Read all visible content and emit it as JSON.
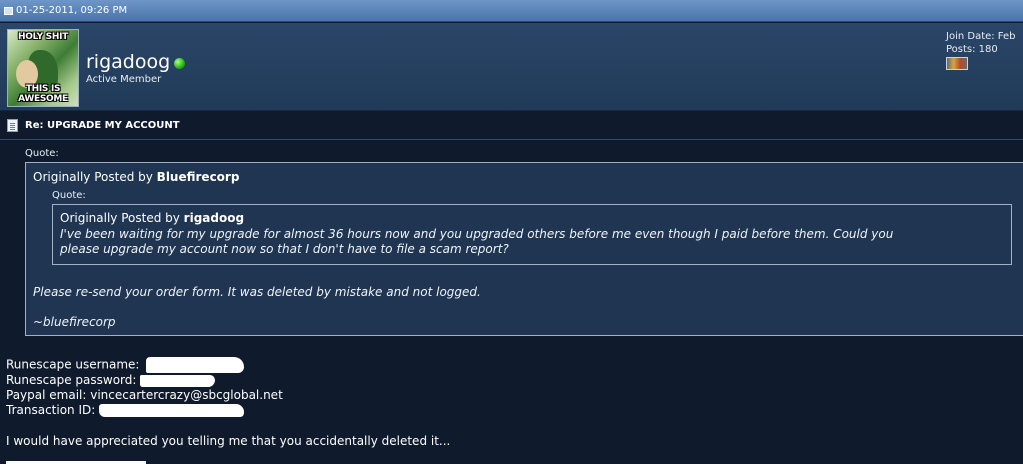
{
  "post": {
    "date": "01-25-2011, 09:26 PM",
    "title": "Re: UPGRADE MY ACCOUNT"
  },
  "user": {
    "username": "rigadoog",
    "title": "Active Member",
    "join_date": "Join Date: Feb",
    "posts": "Posts: 180",
    "avatar_top_text": "HOLY SHIT",
    "avatar_bottom_text": "THIS IS AWESOME"
  },
  "quote_outer": {
    "label": "Quote:",
    "prefix": "Originally Posted by ",
    "author": "Bluefirecorp",
    "message_1": "Please re-send your order form. It was deleted by mistake and not logged.",
    "message_2": "~bluefirecorp"
  },
  "quote_inner": {
    "label": "Quote:",
    "prefix": "Originally Posted by ",
    "author": "rigadoog",
    "line_1": "I've been waiting for my upgrade for almost 36 hours now and you upgraded others before me even though I paid before them. Could you",
    "line_2": "please upgrade my account now so that I don't have to file a scam report?"
  },
  "body": {
    "username_label": "Runescape username:",
    "password_label": "Runescape password:",
    "paypal_label": "Paypal email:",
    "paypal_value": "vincecartercrazy@sbcglobal.net",
    "transaction_label": "Transaction ID:",
    "closing": "I would have appreciated you telling me that you accidentally deleted it..."
  },
  "icons": {
    "date": "post-date-icon",
    "online": "online-status-icon",
    "reputation": "reputation-icon",
    "post": "document-icon"
  },
  "colors": {
    "background": "#0f1b2d",
    "header": "#213a58",
    "datebar": "#4a74aa",
    "quote_border": "#9fb1c6",
    "online": "#29b014"
  }
}
